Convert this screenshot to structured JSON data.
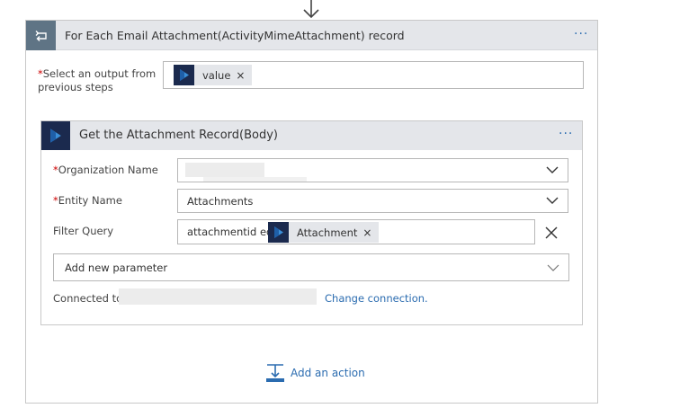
{
  "foreach": {
    "title": "For Each Email Attachment(ActivityMimeAttachment) record",
    "more": "···",
    "select_output": {
      "label_line1": "Select an output from",
      "label_line2": "previous steps",
      "required_mark": "*",
      "token_label": "value",
      "token_remove": "×"
    }
  },
  "action": {
    "title": "Get the Attachment Record(Body)",
    "more": "···",
    "org_name": {
      "label": "Organization Name",
      "required_mark": "*"
    },
    "entity_name": {
      "label": "Entity Name",
      "required_mark": "*",
      "value": "Attachments"
    },
    "filter_query": {
      "label": "Filter Query",
      "prefix_text": "attachmentid eq",
      "token_label": "Attachment",
      "token_remove": "×"
    },
    "add_param": {
      "placeholder": "Add new parameter"
    },
    "connection": {
      "label": "Connected to",
      "change_link": "Change connection."
    }
  },
  "add_action": {
    "label": "Add an action"
  },
  "colors": {
    "accent": "#2b6cb0",
    "header_bg": "#e4e6ea",
    "dynamics_navy": "#1b2a4e",
    "loop_slate": "#5f7485",
    "required": "#cc0000"
  }
}
